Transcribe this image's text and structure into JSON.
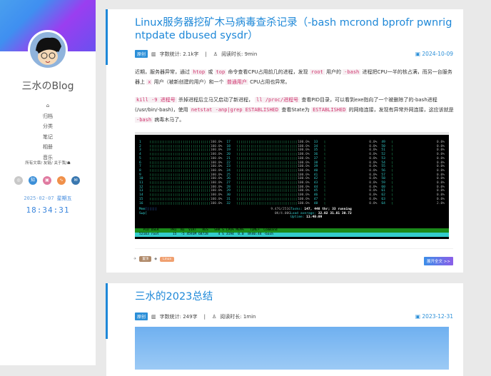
{
  "sidebar": {
    "blog_name": "三水のBlog",
    "nav": [
      "归档",
      "分类",
      "笔记",
      "相册",
      "音乐"
    ],
    "links": "所有文章/ 友链/ 关于我/",
    "date": "2025-02-07",
    "weekday": "星期五",
    "time": "18:34:31",
    "social": [
      {
        "icon": "github-icon",
        "color": "#c8c8c8",
        "glyph": "◎"
      },
      {
        "icon": "zhihu-icon",
        "color": "#3b8fd8",
        "glyph": "知"
      },
      {
        "icon": "bilibili-icon",
        "color": "#e07aa0",
        "glyph": "▣"
      },
      {
        "icon": "rss-icon",
        "color": "#f0904a",
        "glyph": "∿"
      },
      {
        "icon": "email-icon",
        "color": "#3a78b0",
        "glyph": "✉"
      }
    ]
  },
  "posts": [
    {
      "title": "Linux服务器挖矿木马病毒查杀记录（-bash mcrond bprofr pwnrig ntpdate dbused sysdr）",
      "badge": "原创",
      "words": "字数统计: 2.1k字",
      "sep": "|",
      "read": "阅读时长: 9min",
      "date": "2024-10-09",
      "p1": [
        "近期，服务器异常，通过 ",
        "htop",
        " 或 ",
        "top",
        " 命令查看CPU占用前几的进程，发现 ",
        "root",
        " 用户的 ",
        "-bash",
        " 进程把CPU一半的核占满，而另一台服务器上 ",
        "x",
        " 用户（被新创建的用户）和一个 ",
        "普通用户",
        " CPU占用也异常。"
      ],
      "p2": [
        "",
        "kill -9 进程号",
        " 杀掉进程后立马又启动了新进程， ",
        "ll /proc/进程号",
        " 查看PID目录，可以看到exe指向了一个被删除了的-bash进程(/usr/bin/-bash)，使用 ",
        "netstat -anp|grep ESTABLISHED",
        " 查看State为 ",
        "ESTABLISHED",
        " 的网络连接，发现有异常外网连接，这应该就是 ",
        "-bash",
        " 病毒木马了。"
      ],
      "tags": [
        "置顶",
        "Linux"
      ],
      "tag_colors": [
        "#b08a6a",
        "#f0a070"
      ],
      "more": "展开全文 >>"
    },
    {
      "title": "三水的2023总结",
      "badge": "原创",
      "words": "字数统计: 249字",
      "sep": "|",
      "read": "阅读时长: 1min",
      "date": "2023-12-31"
    }
  ],
  "terminal": {
    "busy": "100.0%",
    "idle": "0.0%",
    "cpu64": "2.0%",
    "mem_label": "Mem",
    "mem_value": "9.47G/251G",
    "swp_label": "Swp",
    "swp_value": "0K/4.00G",
    "tasks": "Tasks: ",
    "tasks_n": "147, 448 thr; 33 running",
    "load": "Load average: ",
    "load_n": "32.02 31.81 30.72",
    "uptime": "Uptime: ",
    "uptime_n": "11:40:09",
    "header": "  PID USER      PRI  NI  VIRT   RES   SHR S CPU% MEM%   TIME+  Command",
    "row": "52103 root       15  -5 4593M 68728     4 S 3194  0.0  8h40:44 -bash"
  }
}
